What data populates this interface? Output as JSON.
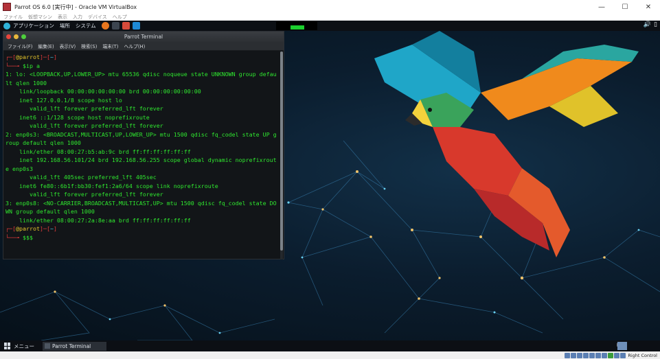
{
  "window": {
    "title": "Parrot OS 6.0 [実行中] - Oracle VM VirtualBox",
    "controls": [
      "—",
      "☐",
      "✕"
    ]
  },
  "vbox_menu": [
    "ファイル",
    "仮想マシン",
    "表示",
    "入力",
    "デバイス",
    "ヘルプ"
  ],
  "top_panel": {
    "items": [
      "アプリケーション",
      "場所",
      "システム"
    ]
  },
  "terminal": {
    "title": "Parrot Terminal",
    "menu": [
      "ファイル(F)",
      "編集(E)",
      "表示(V)",
      "検索(S)",
      "端末(T)",
      "ヘルプ(H)"
    ],
    "lines": [
      {
        "kind": "prompt",
        "user": "@parrot",
        "path": "~"
      },
      {
        "kind": "cmd",
        "text": "$ip a"
      },
      {
        "kind": "out",
        "text": "1: lo: <LOOPBACK,UP,LOWER_UP> mtu 65536 qdisc noqueue state UNKNOWN group default qlen 1000"
      },
      {
        "kind": "out",
        "text": "    link/loopback 00:00:00:00:00:00 brd 00:00:00:00:00:00"
      },
      {
        "kind": "out",
        "text": "    inet 127.0.0.1/8 scope host lo"
      },
      {
        "kind": "out",
        "text": "       valid_lft forever preferred_lft forever"
      },
      {
        "kind": "out",
        "text": "    inet6 ::1/128 scope host noprefixroute"
      },
      {
        "kind": "out",
        "text": "       valid_lft forever preferred_lft forever"
      },
      {
        "kind": "out",
        "text": "2: enp0s3: <BROADCAST,MULTICAST,UP,LOWER_UP> mtu 1500 qdisc fq_codel state UP group default qlen 1000"
      },
      {
        "kind": "out",
        "text": "    link/ether 08:00:27:b5:ab:9c brd ff:ff:ff:ff:ff:ff"
      },
      {
        "kind": "out",
        "text": "    inet 192.168.56.101/24 brd 192.168.56.255 scope global dynamic noprefixroute enp0s3"
      },
      {
        "kind": "out",
        "text": "       valid_lft 405sec preferred_lft 405sec"
      },
      {
        "kind": "out",
        "text": "    inet6 fe80::6b1f:bb30:fef1:2a6/64 scope link noprefixroute"
      },
      {
        "kind": "out",
        "text": "       valid_lft forever preferred_lft forever"
      },
      {
        "kind": "out",
        "text": "3: enp0s8: <NO-CARRIER,BROADCAST,MULTICAST,UP> mtu 1500 qdisc fq_codel state DOWN group default qlen 1000"
      },
      {
        "kind": "out",
        "text": "    link/ether 08:00:27:2a:8e:aa brd ff:ff:ff:ff:ff:ff"
      },
      {
        "kind": "prompt",
        "user": "@parrot",
        "path": "~"
      },
      {
        "kind": "cmd",
        "text": "$$$"
      }
    ]
  },
  "taskbar": {
    "menu_label": "メニュー",
    "task_label": "Parrot Terminal"
  },
  "status_bar": {
    "host_key": "Right Control"
  },
  "colors": {
    "terminal_text": "#2fe82f",
    "prompt_red": "#e23a3a",
    "prompt_user": "#e6c52a",
    "prompt_path": "#4dc7e6",
    "cpu_bar": "#1ccf2e"
  }
}
